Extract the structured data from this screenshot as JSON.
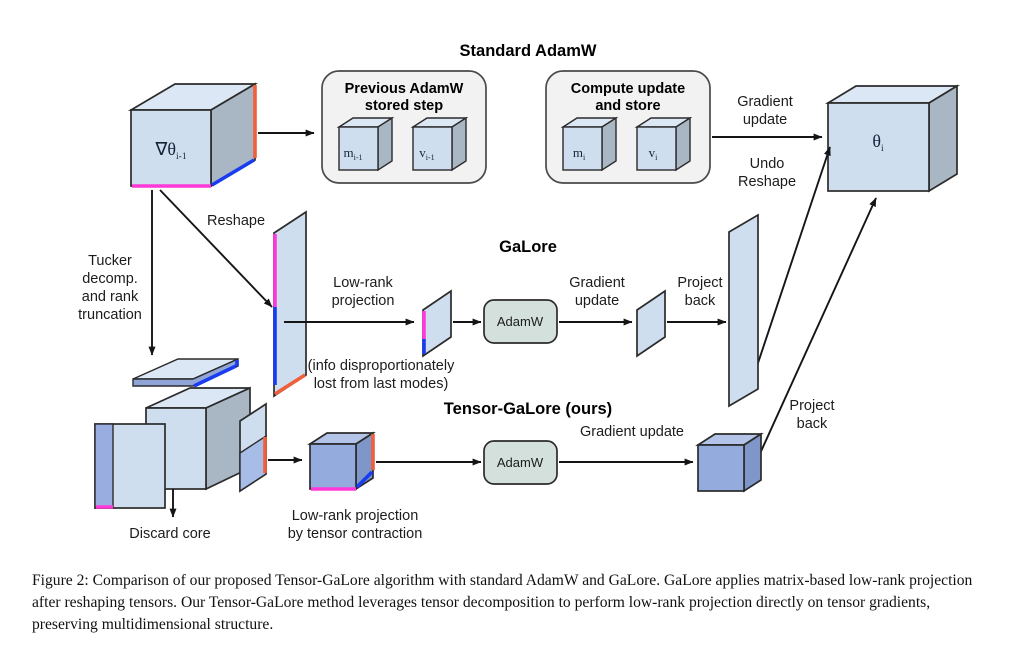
{
  "figure": {
    "caption": "Figure 2: Comparison of our proposed Tensor-GaLore algorithm with standard AdamW and GaLore. GaLore applies matrix-based low-rank projection after reshaping tensors. Our Tensor-GaLore method leverages tensor decomposition to perform low-rank projection directly on tensor gradients, preserving multidimensional structure."
  },
  "section_headers": {
    "standard_adamw": "Standard AdamW",
    "galore": "GaLore",
    "tensor_galore": "Tensor-GaLore (ours)"
  },
  "tensors": {
    "gradient": "∇θ",
    "gradient_sub": "i-1",
    "theta": "θ",
    "theta_sub": "i"
  },
  "adamw_panels": [
    {
      "title_line1": "Previous AdamW",
      "title_line2": "stored step",
      "slots": [
        {
          "symbol": "m",
          "sub": "i-1"
        },
        {
          "symbol": "v",
          "sub": "i-1"
        }
      ]
    },
    {
      "title_line1": "Compute update",
      "title_line2": "and store",
      "slots": [
        {
          "symbol": "m",
          "sub": "i"
        },
        {
          "symbol": "v",
          "sub": "i"
        }
      ]
    }
  ],
  "optimizer_blocks": [
    {
      "label": "AdamW"
    },
    {
      "label": "AdamW"
    }
  ],
  "edge_labels": {
    "gradient_update_top": "Gradient\nupdate",
    "gradient_update_top_l1": "Gradient",
    "gradient_update_top_l2": "update",
    "undo_reshape_l1": "Undo",
    "undo_reshape_l2": "Reshape",
    "reshape": "Reshape",
    "tucker_l1": "Tucker",
    "tucker_l2": "decomp.",
    "tucker_l3": "and rank",
    "tucker_l4": "truncation",
    "lowrank_proj_l1": "Low-rank",
    "lowrank_proj_l2": "projection",
    "info_lost_l1": "(info disproportionately",
    "info_lost_l2": "lost from last modes)",
    "galore_grad_update_l1": "Gradient",
    "galore_grad_update_l2": "update",
    "project_back_mid_l1": "Project",
    "project_back_mid_l2": "back",
    "project_back_bottom_l1": "Project",
    "project_back_bottom_l2": "back",
    "discard_core": "Discard core",
    "lowrank_contraction_l1": "Low-rank projection",
    "lowrank_contraction_l2": "by tensor contraction",
    "tensor_grad_update": "Gradient update"
  },
  "colors": {
    "cube_front": "#cfdeef",
    "cube_top": "#dbe7f4",
    "cube_side": "#a9b6c4",
    "cube_blue_front": "#93abdd",
    "cube_blue_top": "#b3c4e8",
    "cube_blue_side": "#7f96c8",
    "panel_fill": "#f2f2f2",
    "panel_stroke": "#4a4a4a",
    "adamw_fill": "#d3e0dc",
    "adamw_stroke": "#2b2b2b",
    "accent_magenta": "#ff39d8",
    "accent_blue": "#1a3cf0",
    "accent_orange": "#ef5f3c",
    "outline": "#2b2b2b",
    "arrow": "#151515",
    "text": "#1c1c1c",
    "background": "#ffffff"
  }
}
